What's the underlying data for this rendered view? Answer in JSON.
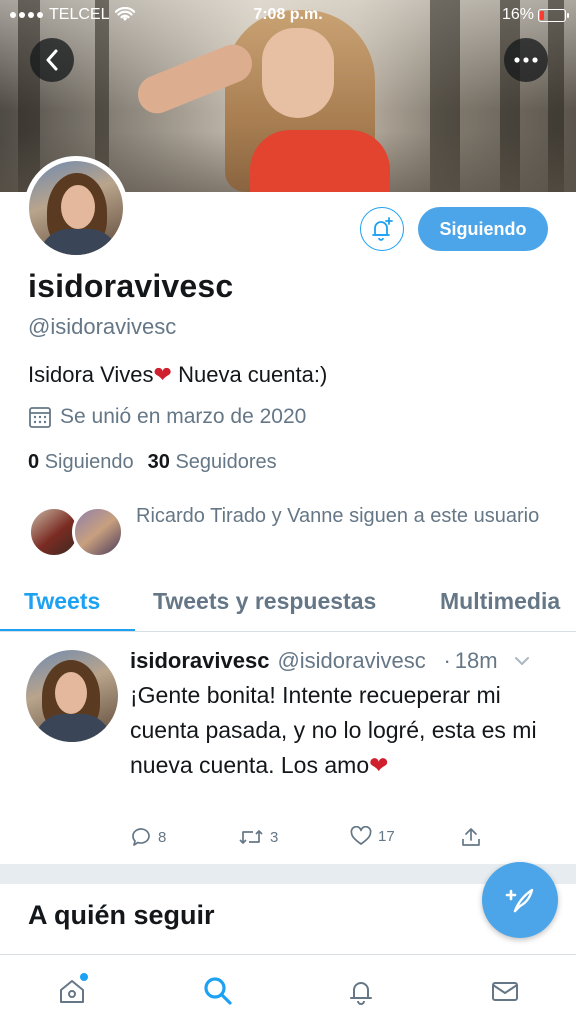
{
  "status_bar": {
    "carrier": "TELCEL",
    "time": "7:08 p.m.",
    "battery": "16%",
    "battery_level": 0.16
  },
  "header": {
    "back_icon": "chevron-left-icon",
    "more_icon": "more-horizontal-icon"
  },
  "profile": {
    "follow_button_label": "Siguiendo",
    "notification_icon": "bell-plus-icon",
    "display_name": "isidoravivesc",
    "handle": "@isidoravivesc",
    "bio_text": "Isidora Vives",
    "bio_suffix": " Nueva cuenta:)",
    "joined": "Se unió en marzo de 2020",
    "following_count": "0",
    "following_label": "Siguiendo",
    "followers_count": "30",
    "followers_label": "Seguidores",
    "followed_by_text": "Ricardo Tirado y Vanne siguen a este usuario"
  },
  "tabs": [
    {
      "label": "Tweets",
      "active": true
    },
    {
      "label": "Tweets y respuestas",
      "active": false
    },
    {
      "label": "Multimedia",
      "active": false
    }
  ],
  "tweet": {
    "name": "isidoravivesc",
    "handle": "@isidoravivesc",
    "separator": "·",
    "age": "18m",
    "text": "¡Gente bonita! Intente recueperar mi cuenta pasada, y no lo logré, esta es mi nueva cuenta. Los amo",
    "reply_count": "8",
    "retweet_count": "3",
    "like_count": "17"
  },
  "who_to_follow_title": "A quién seguir",
  "bottom_nav": [
    {
      "icon": "home-icon"
    },
    {
      "icon": "search-icon"
    },
    {
      "icon": "notifications-icon"
    },
    {
      "icon": "messages-icon"
    }
  ],
  "colors": {
    "accent": "#1da1f2",
    "button_fill": "#4ca5e9",
    "secondary_text": "#657786",
    "heart": "#d0202e"
  }
}
